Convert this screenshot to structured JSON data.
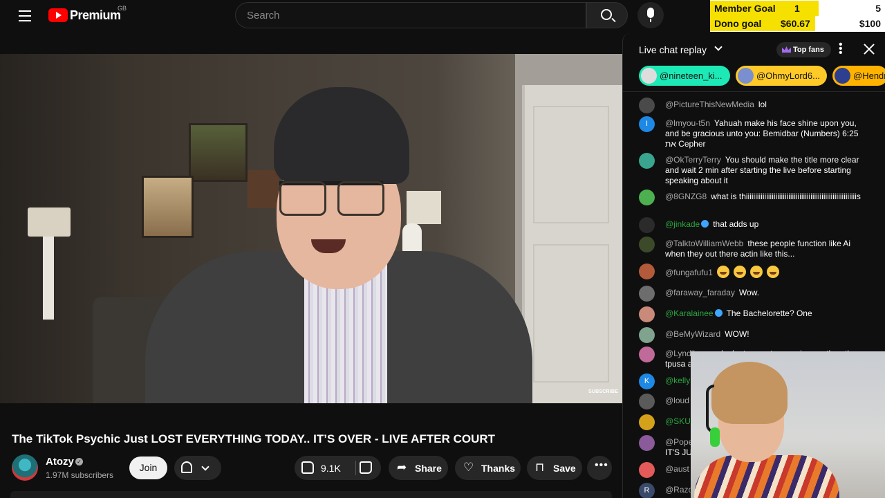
{
  "header": {
    "logo_text": "Premium",
    "country_code": "GB",
    "search_placeholder": "Search"
  },
  "goals": {
    "member_label": "Member Goal",
    "member_current": "1",
    "member_target": "5",
    "member_progress": 0.2,
    "dono_label": "Dono goal",
    "dono_current": "$60.67",
    "dono_target": "$100",
    "dono_progress": 0.6067
  },
  "video": {
    "watermark": "SUBSCRIBE",
    "title": "The TikTok Psychic Just LOST EVERYTHING TODAY.. IT’S OVER - LIVE AFTER COURT"
  },
  "channel": {
    "name": "Atozy",
    "subscribers": "1.97M subscribers",
    "join_label": "Join"
  },
  "actions": {
    "likes": "9.1K",
    "share": "Share",
    "thanks": "Thanks",
    "save": "Save"
  },
  "chat": {
    "title": "Live chat replay",
    "top_fans": "Top fans",
    "tickers": [
      "@nineteen_ki...",
      "@OhmyLord6...",
      "@Hendr"
    ],
    "messages": [
      {
        "author": "@PictureThisNewMedia",
        "text": "lol",
        "avatar": "",
        "avatar_color": "#4a4a4a"
      },
      {
        "author": "@lmyou-t5n",
        "text": "Yahuah make his face shine upon you, and be gracious unto you: Bemidbar (Numbers) 6:25 את Cepher",
        "avatar": "I",
        "avatar_color": "#1e88e5"
      },
      {
        "author": "@OkTerryTerry",
        "text": "You should make the title more clear and wait 2 min after starting the live before starting speaking about it",
        "avatar": "",
        "avatar_color": "#3aa58f"
      },
      {
        "author": "@8GNZG8",
        "text": "what is thiiiiiiiiiiiiiiiiiiiiiiiiiiiiiiiiiiiiiiiiiiiiiiiiiiiiiiiiiiiis",
        "avatar": "",
        "avatar_color": "#4caf50"
      },
      {
        "author": "@jinkade",
        "text": "that adds up",
        "avatar": "",
        "avatar_color": "#2b2b2b"
      },
      {
        "author": "@TalktoWilliamWebb",
        "text": "these people function like Ai when they out there actin like this...",
        "avatar": "",
        "avatar_color": "#3c4a2a"
      },
      {
        "author": "@fungafufu1",
        "text": "",
        "avatar": "",
        "avatar_color": "#b35a3a"
      },
      {
        "author": "@faraway_faraday",
        "text": "Wow.",
        "avatar": "",
        "avatar_color": "#6d6d6d"
      },
      {
        "author": "@Karalainee",
        "text": "The Bachelorette? One",
        "avatar": "",
        "avatar_color": "#c98a7a"
      },
      {
        "author": "@BeMyWizard",
        "text": "WOW!",
        "avatar": "",
        "avatar_color": "#7fa38e"
      },
      {
        "author": "@Lyndilee",
        "text": "aw look atozy got more viewers than the tpusa a",
        "avatar": "",
        "avatar_color": "#c06a9a"
      },
      {
        "author": "@kelly",
        "text": "",
        "avatar": "K",
        "avatar_color": "#1e88e5"
      },
      {
        "author": "@loud",
        "text": "",
        "avatar": "",
        "avatar_color": "#5a5a5a"
      },
      {
        "author": "@SKUI",
        "text": "",
        "avatar": "",
        "avatar_color": "#d4a21a"
      },
      {
        "author": "@Pope",
        "text": "IT'S JU",
        "avatar": "",
        "avatar_color": "#8a5a9a"
      },
      {
        "author": "@aust",
        "text": "",
        "avatar": "",
        "avatar_color": "#e25a5a"
      },
      {
        "author": "@Razo",
        "text": "",
        "avatar": "R",
        "avatar_color": "#3a4a6a"
      }
    ]
  },
  "colors": {
    "goal_yellow": "#f6e000",
    "brand_red": "#ff0000",
    "mod_green": "#2ba640",
    "ticker_green": "#1de9b6",
    "ticker_yellow": "#ffca28"
  }
}
